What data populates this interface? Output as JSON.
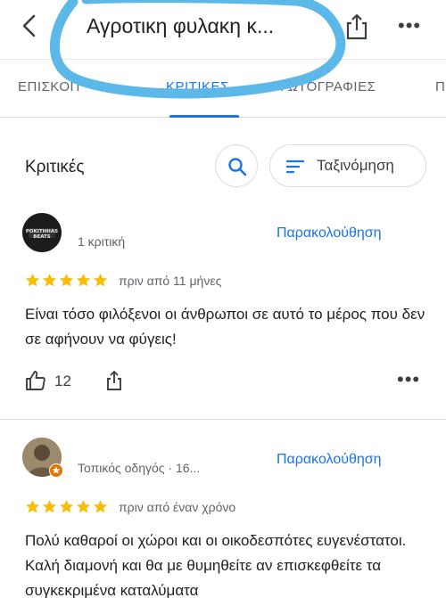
{
  "header": {
    "title": "Αγροτικη φυλακη κ...",
    "back_icon": "arrow-back-icon",
    "share_icon": "share-icon",
    "more_icon": "more-horizontal-icon",
    "more_label": "•••"
  },
  "tabs": [
    {
      "label": "ΕΠΙΣΚΟΠ"
    },
    {
      "label": "ΚΡΙΤΙΚΕΣ"
    },
    {
      "label": "ΦΩΤΟΓΡΑΦΙΕΣ"
    },
    {
      "label": "Π"
    }
  ],
  "active_tab": "ΚΡΙΤΙΚΕΣ",
  "section": {
    "title": "Κριτικές",
    "search_icon": "search-icon",
    "sort_label": "Ταξινόμηση",
    "sort_icon": "sort-icon"
  },
  "reviews": [
    {
      "avatar_text": "POKITHHAS BEATS",
      "meta": "1 κριτική",
      "follow_label": "Παρακολούθηση",
      "stars": 5,
      "date": "πριν από 11 μήνες",
      "text": "Είναι τόσο φιλόξενοι οι άνθρωποι σε αυτό το μέρος που δεν σε αφήνουν να φύγεις!",
      "likes": "12",
      "more_label": "•••"
    },
    {
      "meta": "Τοπικός οδηγός · 16...",
      "follow_label": "Παρακολούθηση",
      "stars": 5,
      "date": "πριν από έναν χρόνο",
      "text": "Πολύ καθαροί οι χώροι και οι οικοδεσπότες ευγενέστατοι. Καλή διαμονή και θα με θυμηθείτε αν επισκεφθείτε τα συγκεκριμένα καταλύματα"
    }
  ],
  "colors": {
    "accent": "#1a73e8",
    "star": "#fbbc04",
    "scribble": "#5bb8e8"
  }
}
